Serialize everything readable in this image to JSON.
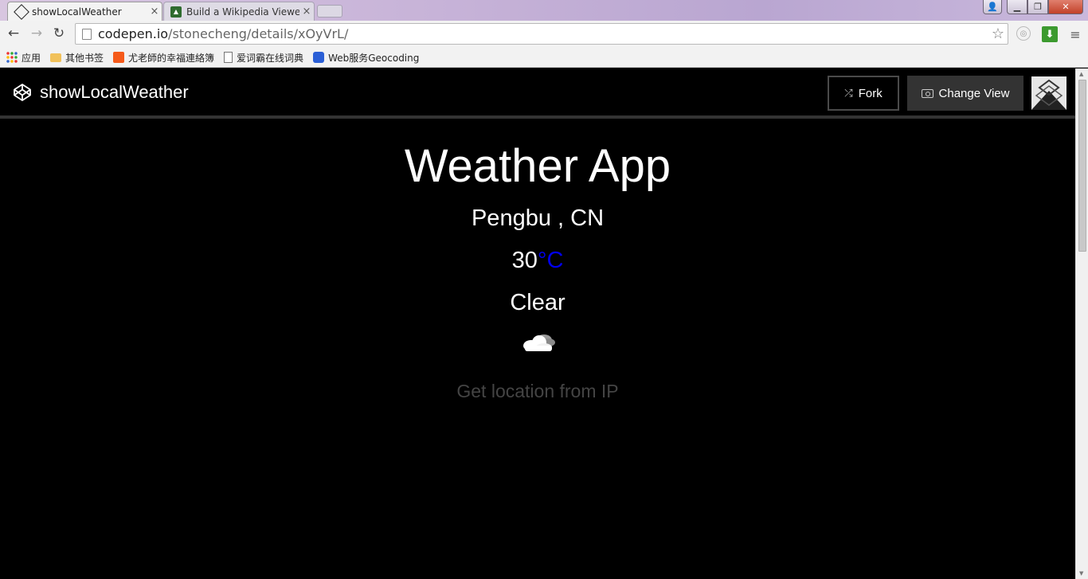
{
  "browser": {
    "tabs": [
      {
        "title": "showLocalWeather",
        "close": "×"
      },
      {
        "title": "Build a Wikipedia Viewe",
        "close": "×"
      }
    ],
    "address": {
      "host": "codepen.io",
      "path": "/stonecheng/details/xOyVrL/"
    },
    "bookmarks": [
      {
        "label": "应用",
        "icon": "apps-icon"
      },
      {
        "label": "其他书签",
        "icon": "folder-icon"
      },
      {
        "label": "尤老師的幸福連絡簿",
        "icon": "soundcloud-icon"
      },
      {
        "label": "爱词霸在线词典",
        "icon": "page-icon"
      },
      {
        "label": "Web服务Geocoding",
        "icon": "paw-icon"
      }
    ]
  },
  "codepen": {
    "title": "showLocalWeather",
    "fork_label": "Fork",
    "change_view_label": "Change View"
  },
  "weather": {
    "heading": "Weather App",
    "location": "Pengbu , CN",
    "temperature": "30",
    "unit": "°C",
    "condition": "Clear",
    "icon": "cloud-icon",
    "action_label": "Get location from IP",
    "unit_color": "#0000ee"
  }
}
